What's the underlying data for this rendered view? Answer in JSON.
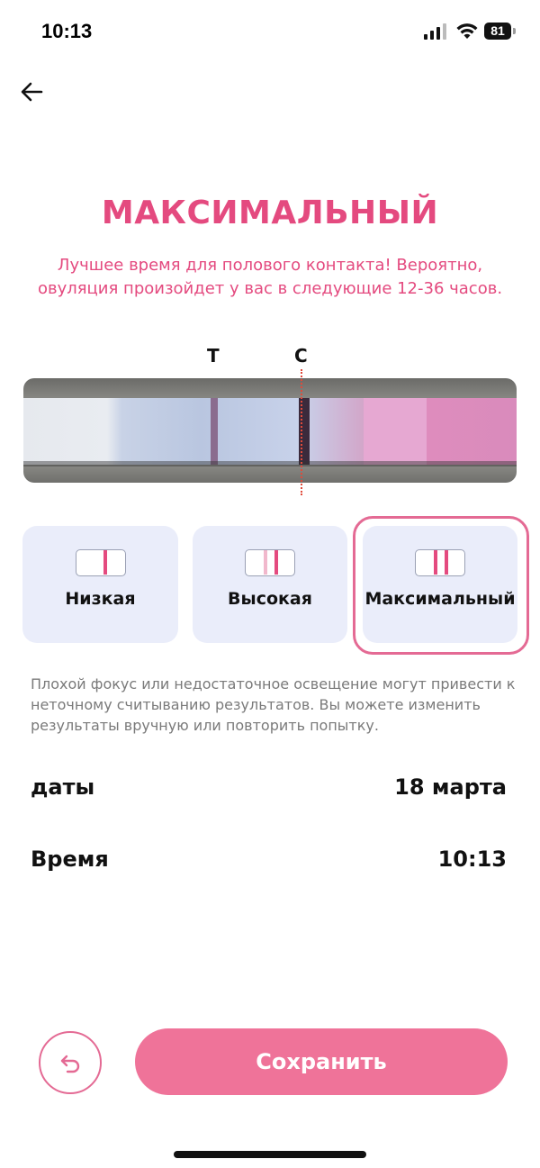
{
  "status_bar": {
    "time": "10:13",
    "battery": "81",
    "signal_icon": "cellular-signal-icon",
    "wifi_icon": "wifi-icon"
  },
  "nav": {
    "back_icon": "arrow-left-icon"
  },
  "result": {
    "title": "МАКСИМАЛЬНЫЙ",
    "description": "Лучшее время для полового контакта! Вероятно, овуляция произойдет у вас в следующие 12-36 часов.",
    "color": "#e44a7f"
  },
  "strip": {
    "label_t": "T",
    "label_c": "C"
  },
  "levels": {
    "options": [
      {
        "label": "Низкая",
        "selected": false
      },
      {
        "label": "Высокая",
        "selected": false
      },
      {
        "label": "Максимальный",
        "selected": true
      }
    ]
  },
  "hint": "Плохой фокус или недостаточное освещение могут привести к неточному считыванию результатов. Вы можете изменить результаты вручную или повторить попытку.",
  "details": {
    "date_label": "даты",
    "date_value": "18 марта",
    "time_label": "Время",
    "time_value": "10:13"
  },
  "actions": {
    "undo_icon": "undo-icon",
    "save_label": "Сохранить",
    "accent_color": "#ef7399"
  }
}
